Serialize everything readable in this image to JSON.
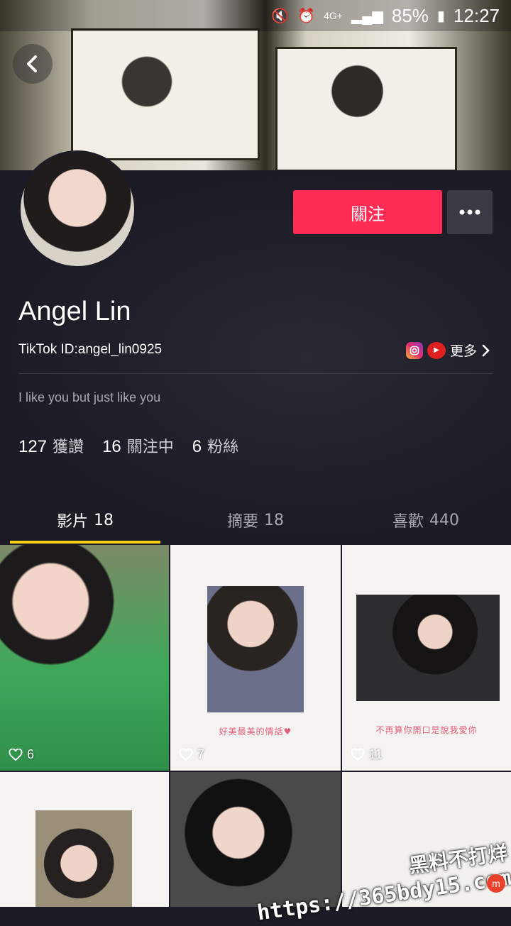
{
  "status_bar": {
    "network": "4G+",
    "battery": "85%",
    "time": "12:27"
  },
  "profile": {
    "name": "Angel Lin",
    "tiktok_id": "TikTok ID:angel_lin0925",
    "bio": "I like you but just like you",
    "follow_label": "關注",
    "more_links_label": "更多",
    "stats": [
      {
        "value": "127",
        "label": "獲讚"
      },
      {
        "value": "16",
        "label": "關注中"
      },
      {
        "value": "6",
        "label": "粉絲"
      }
    ]
  },
  "tabs": [
    {
      "label": "影片",
      "count": "18"
    },
    {
      "label": "摘要",
      "count": "18"
    },
    {
      "label": "喜歡",
      "count": "440"
    }
  ],
  "videos": [
    {
      "likes": "6",
      "caption": ""
    },
    {
      "likes": "7",
      "caption": "好美最美的情話♥"
    },
    {
      "likes": "11",
      "caption": "不再算你開口是說我愛你"
    },
    {
      "likes": "",
      "caption": ""
    },
    {
      "likes": "",
      "caption": ""
    },
    {
      "likes": "",
      "caption": ""
    }
  ],
  "watermark": {
    "line1": "黑料不打烊",
    "line2": "https://365bdy15.com",
    "badge": "m"
  }
}
